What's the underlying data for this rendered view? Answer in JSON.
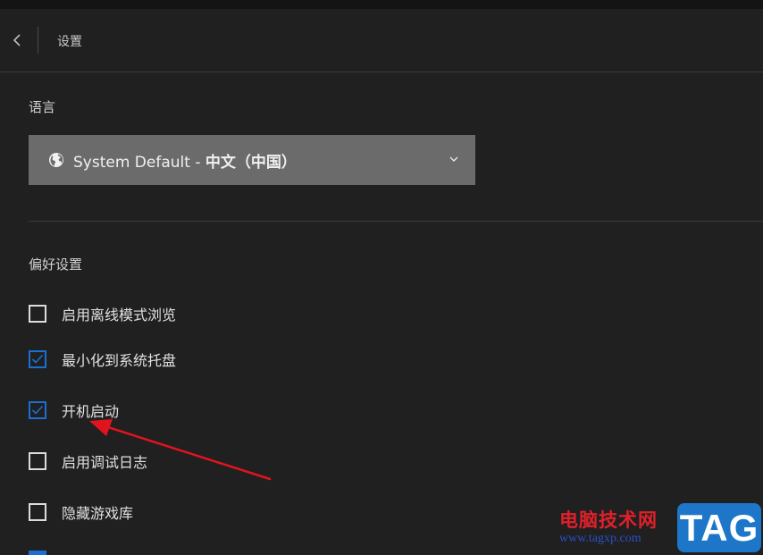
{
  "header": {
    "title": "设置",
    "back_icon": "chevron-left-icon"
  },
  "language": {
    "section_label": "语言",
    "select_prefix": "System Default - ",
    "select_value": "中文（中国）",
    "icon": "globe-icon"
  },
  "preferences": {
    "section_label": "偏好设置",
    "items": [
      {
        "label": "启用离线模式浏览",
        "checked": false
      },
      {
        "label": "最小化到系统托盘",
        "checked": true
      },
      {
        "label": "开机启动",
        "checked": true
      },
      {
        "label": "启用调试日志",
        "checked": false
      },
      {
        "label": "隐藏游戏库",
        "checked": false
      }
    ]
  },
  "watermark": {
    "site_name": "电脑技术网",
    "url": "www.tagxp.com",
    "badge": "TAG"
  },
  "colors": {
    "background": "#202020",
    "select_bg": "#6b6b6b",
    "check_accent": "#1b6fd1",
    "annotation_arrow": "#e0141e"
  }
}
